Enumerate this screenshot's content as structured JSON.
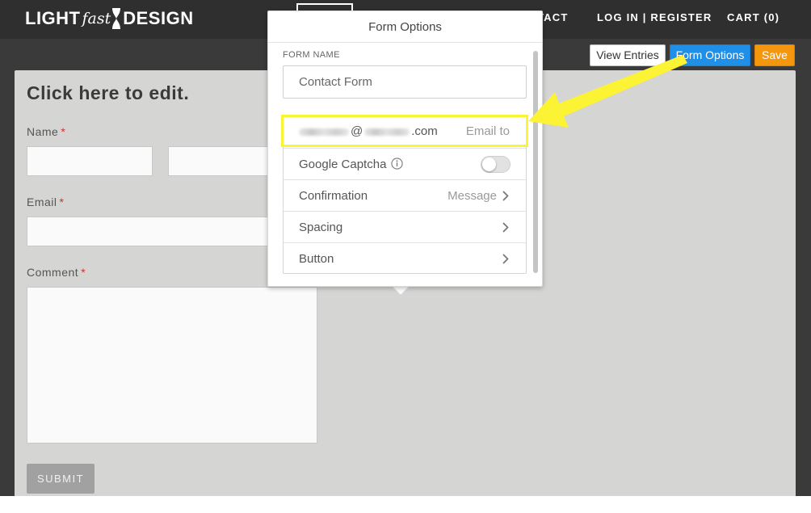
{
  "site": {
    "logo_light": "LIGHT",
    "logo_fast": "fast",
    "logo_design": "DESIGN"
  },
  "nav": {
    "contact_partial": "TACT",
    "login_register": "LOG IN | REGISTER",
    "cart": "CART (0)"
  },
  "toolbar": {
    "view_entries": "View Entries",
    "form_options": "Form Options",
    "save": "Save"
  },
  "form": {
    "title": "Click here to edit.",
    "name_label": "Name",
    "email_label": "Email",
    "comment_label": "Comment",
    "required_mark": "*",
    "submit_label": "SUBMIT"
  },
  "popover": {
    "title": "Form Options",
    "form_name_label": "FORM NAME",
    "form_name_value": "Contact Form",
    "email_at": "@",
    "email_suffix": ".com",
    "email_to_label": "Email to",
    "captcha_label": "Google Captcha",
    "captcha_enabled": false,
    "confirmation_label": "Confirmation",
    "confirmation_value": "Message",
    "spacing_label": "Spacing",
    "button_label": "Button"
  },
  "colors": {
    "topbar": "#2f2f2f",
    "app_background": "#3a3a3a",
    "canvas": "#d5d5d4",
    "primary_button": "#1f8fe8",
    "save_button": "#f4970f",
    "required": "#d0312d",
    "annotation": "#fbf334"
  },
  "icons": {
    "logo_mark": "hourglass-icon",
    "captcha_info": "info-icon",
    "row_chevron": "chevron-right-icon",
    "annotation_arrow": "arrow-icon"
  }
}
